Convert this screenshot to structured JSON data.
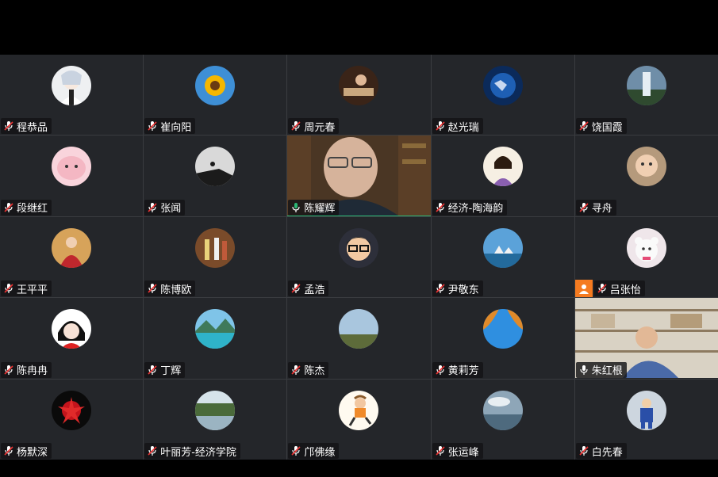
{
  "participants": [
    {
      "name": "程恭品",
      "mic": "muted",
      "avatar": "anime-girl-avatar"
    },
    {
      "name": "崔向阳",
      "mic": "muted",
      "avatar": "sunflower-avatar"
    },
    {
      "name": "周元春",
      "mic": "muted",
      "avatar": "piano-avatar"
    },
    {
      "name": "赵光瑞",
      "mic": "muted",
      "avatar": "earth-night-avatar"
    },
    {
      "name": "饶国霞",
      "mic": "muted",
      "avatar": "waterfall-avatar"
    },
    {
      "name": "段继红",
      "mic": "muted",
      "avatar": "pink-blob-avatar"
    },
    {
      "name": "张闻",
      "mic": "muted",
      "avatar": "hiker-silhouette-avatar"
    },
    {
      "name": "陈耀辉",
      "mic": "active",
      "avatar": "video-man-glasses"
    },
    {
      "name": "经济-陶海韵",
      "mic": "muted",
      "avatar": "cartoon-woman-avatar"
    },
    {
      "name": "寻舟",
      "mic": "muted",
      "avatar": "baby-avatar"
    },
    {
      "name": "王平平",
      "mic": "muted",
      "avatar": "red-dress-avatar"
    },
    {
      "name": "陈博欧",
      "mic": "muted",
      "avatar": "dancers-avatar"
    },
    {
      "name": "孟浩",
      "mic": "muted",
      "avatar": "cartoon-man-glasses-avatar"
    },
    {
      "name": "尹敬东",
      "mic": "muted",
      "avatar": "opera-house-avatar"
    },
    {
      "name": "吕张怡",
      "mic": "muted",
      "avatar": "teddy-bear-avatar"
    },
    {
      "name": "陈冉冉",
      "mic": "muted",
      "avatar": "anime-red-avatar"
    },
    {
      "name": "丁辉",
      "mic": "muted",
      "avatar": "mountain-lake-avatar"
    },
    {
      "name": "陈杰",
      "mic": "muted",
      "avatar": "sky-field-avatar"
    },
    {
      "name": "黄莉芳",
      "mic": "muted",
      "avatar": "blue-sky-tree-avatar"
    },
    {
      "name": "朱红根",
      "mic": "unmuted",
      "avatar": "video-man-bookshelf"
    },
    {
      "name": "杨默深",
      "mic": "muted",
      "avatar": "red-flower-avatar"
    },
    {
      "name": "叶丽芳-经济学院",
      "mic": "muted",
      "avatar": "lake-trees-avatar"
    },
    {
      "name": "邝佛缘",
      "mic": "muted",
      "avatar": "cartoon-runner-avatar"
    },
    {
      "name": "张运峰",
      "mic": "muted",
      "avatar": "cloudy-lake-avatar"
    },
    {
      "name": "白先春",
      "mic": "muted",
      "avatar": "child-blue-avatar"
    }
  ],
  "colors": {
    "background": "#000000",
    "tile": "#24262a",
    "active_border": "#2bb673",
    "badge_orange": "#f57b20"
  }
}
